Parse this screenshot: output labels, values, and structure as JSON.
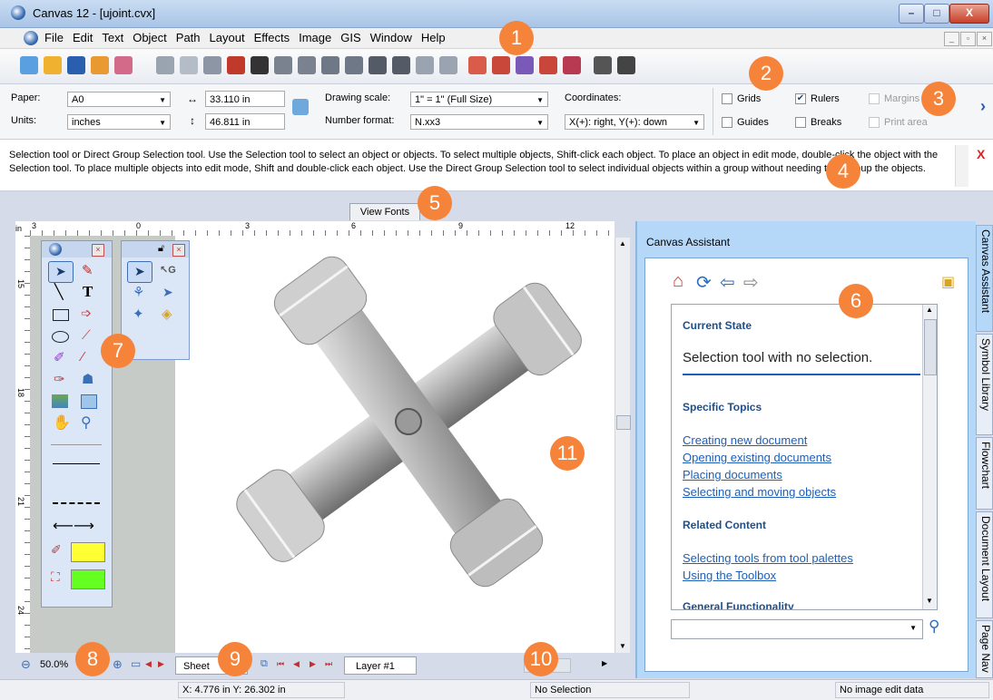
{
  "window": {
    "title": "Canvas 12 - [ujoint.cvx]",
    "min": "–",
    "max": "□",
    "close": "X"
  },
  "menubar": {
    "items": [
      "File",
      "Edit",
      "Text",
      "Object",
      "Path",
      "Layout",
      "Effects",
      "Image",
      "GIS",
      "Window",
      "Help"
    ]
  },
  "properties": {
    "paper_label": "Paper:",
    "paper_value": "A0",
    "units_label": "Units:",
    "units_value": "inches",
    "width_value": "33.110 in",
    "height_value": "46.811 in",
    "scale_label": "Drawing scale:",
    "scale_value": "1\" = 1\"  (Full Size)",
    "format_label": "Number format:",
    "format_value": "N.xx3",
    "coords_label": "Coordinates:",
    "coords_value": "X(+): right, Y(+): down",
    "grids": "Grids",
    "rulers": "Rulers",
    "margins": "Margins",
    "guides": "Guides",
    "breaks": "Breaks",
    "print_area": "Print area",
    "more": "›"
  },
  "help_text": "Selection tool or Direct Group Selection tool. Use the Selection tool to select an object or objects. To select multiple objects, Shift-click each object. To place an object in edit mode, double-click the object with the Selection tool. To place multiple objects into edit mode, Shift and double-click each object. Use the Direct Group Selection tool to select individual objects within a group without needing to ungroup the objects.",
  "help_close": "X",
  "view_fonts": "View Fonts",
  "ruler": {
    "unit": "in",
    "h_ticks": [
      "3",
      "0",
      "3",
      "6",
      "9",
      "12"
    ],
    "v_ticks": [
      "15",
      "18",
      "21",
      "24"
    ]
  },
  "assistant": {
    "title": "Canvas Assistant",
    "current_state_heading": "Current State",
    "current_state": "Selection tool with no selection.",
    "specific_heading": "Specific Topics",
    "specific_links": [
      "Creating new document",
      "Opening existing documents",
      "Placing documents",
      "Selecting and moving objects"
    ],
    "related_heading": "Related Content",
    "related_links": [
      "Selecting tools from tool palettes",
      "Using the Toolbox"
    ],
    "general_heading": "General Functionality"
  },
  "side_tabs": [
    "Canvas Assistant",
    "Symbol Library",
    "Flowchart",
    "Document Layout",
    "Page Nav"
  ],
  "bottom": {
    "zoom": "50.0%",
    "sheet": "Sheet",
    "layer": "Layer #1"
  },
  "status": {
    "coords": "X: 4.776 in  Y: 26.302 in",
    "selection": "No Selection",
    "image": "No image edit data"
  },
  "callouts": [
    "1",
    "2",
    "3",
    "4",
    "5",
    "6",
    "7",
    "8",
    "9",
    "10",
    "11"
  ],
  "colors": {
    "fill_swatch": "#ffff33",
    "stroke_swatch": "#66ff22",
    "callout": "#f5833a"
  }
}
